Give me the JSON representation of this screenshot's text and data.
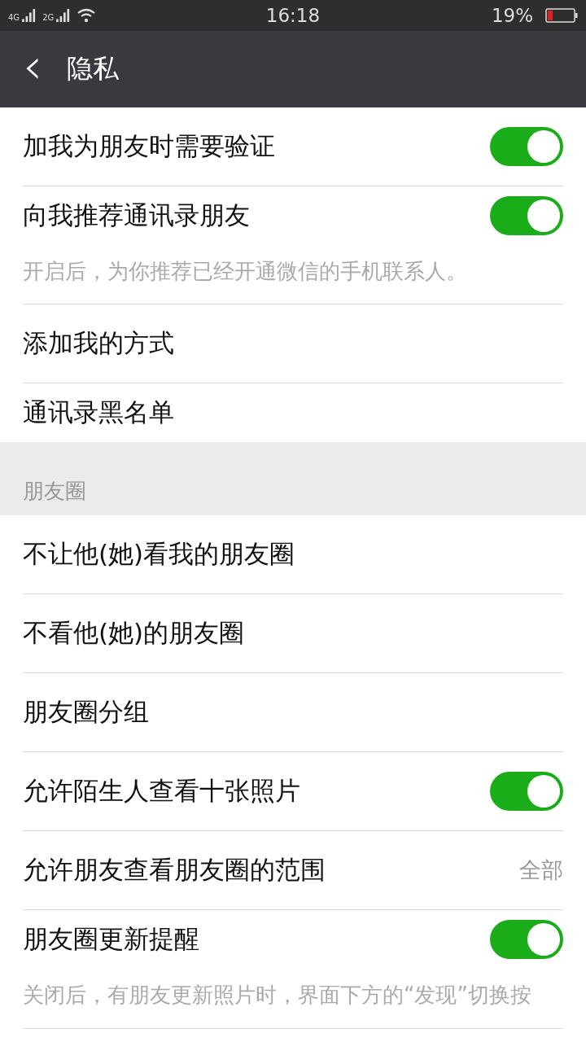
{
  "status_bar": {
    "network_1": "4G",
    "network_2": "2G",
    "time": "16:18",
    "battery": "19%"
  },
  "header": {
    "back": "‹",
    "title": "隐私"
  },
  "sections": [
    {
      "rows": [
        {
          "kind": "toggle",
          "label": "加我为朋友时需要验证",
          "on": true
        },
        {
          "kind": "toggle",
          "label": "向我推荐通讯录朋友",
          "on": true
        },
        {
          "kind": "note",
          "label": "开启后，为你推荐已经开通微信的手机联系人。"
        },
        {
          "kind": "link",
          "label": "添加我的方式"
        },
        {
          "kind": "link",
          "label": "通讯录黑名单"
        }
      ]
    },
    {
      "title": "朋友圈",
      "rows": [
        {
          "kind": "link",
          "label": "不让他(她)看我的朋友圈"
        },
        {
          "kind": "link",
          "label": "不看他(她)的朋友圈"
        },
        {
          "kind": "link",
          "label": "朋友圈分组"
        },
        {
          "kind": "toggle",
          "label": "允许陌生人查看十张照片",
          "on": true
        },
        {
          "kind": "value",
          "label": "允许朋友查看朋友圈的范围",
          "value": "全部"
        },
        {
          "kind": "toggle",
          "label": "朋友圈更新提醒",
          "on": true
        },
        {
          "kind": "note",
          "label": "关闭后，有朋友更新照片时，界面下方的“发现”切换按"
        }
      ]
    }
  ]
}
